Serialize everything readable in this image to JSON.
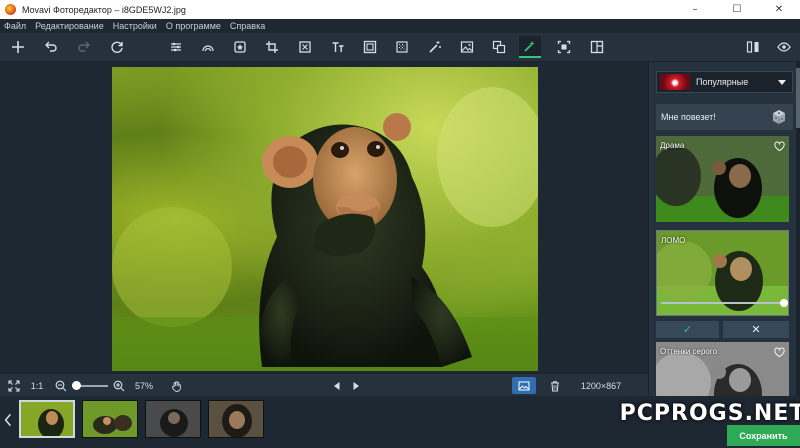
{
  "window": {
    "title": "Movavi Фоторедактор – i8GDE5WJ2.jpg",
    "controls": {
      "minimize": "–",
      "maximize": "☐",
      "close": "✕"
    }
  },
  "menu": {
    "items": [
      "Файл",
      "Редактирование",
      "Настройки",
      "О программе",
      "Справка"
    ]
  },
  "toolbar": {
    "tools": [
      {
        "name": "add-icon"
      },
      {
        "name": "undo-icon"
      },
      {
        "name": "redo-icon"
      },
      {
        "name": "reset-icon"
      },
      {
        "name": "adjust-icon"
      },
      {
        "name": "retouch-icon"
      },
      {
        "name": "enhance-icon"
      },
      {
        "name": "crop-icon"
      },
      {
        "name": "resize-icon"
      },
      {
        "name": "text-icon"
      },
      {
        "name": "frame-icon"
      },
      {
        "name": "noise-icon"
      },
      {
        "name": "magic-icon"
      },
      {
        "name": "background-icon"
      },
      {
        "name": "object-icon"
      },
      {
        "name": "effects-icon"
      },
      {
        "name": "select-icon"
      },
      {
        "name": "compare-icon"
      }
    ],
    "right_tools": [
      {
        "name": "split-view-icon"
      },
      {
        "name": "preview-eye-icon"
      }
    ]
  },
  "bottombar": {
    "fit_label": "",
    "actual_size": "1:1",
    "zoom": "57%",
    "dimensions": "1200×867"
  },
  "sidepanel": {
    "category": "Популярные",
    "lucky": "Мне повезет!",
    "filters": [
      {
        "name": "Драма"
      },
      {
        "name": "ЛОМО"
      },
      {
        "name": "Оттенки серого"
      }
    ],
    "apply": "✓",
    "cancel": "✕"
  },
  "filmstrip": {
    "count": 4,
    "selected": 0
  },
  "save_button": "Сохранить",
  "watermark": "PCPROGS.NET",
  "colors": {
    "accent": "#35c46f",
    "save": "#2eaa57",
    "toolbar": "#25323e",
    "background": "#1e2833"
  }
}
